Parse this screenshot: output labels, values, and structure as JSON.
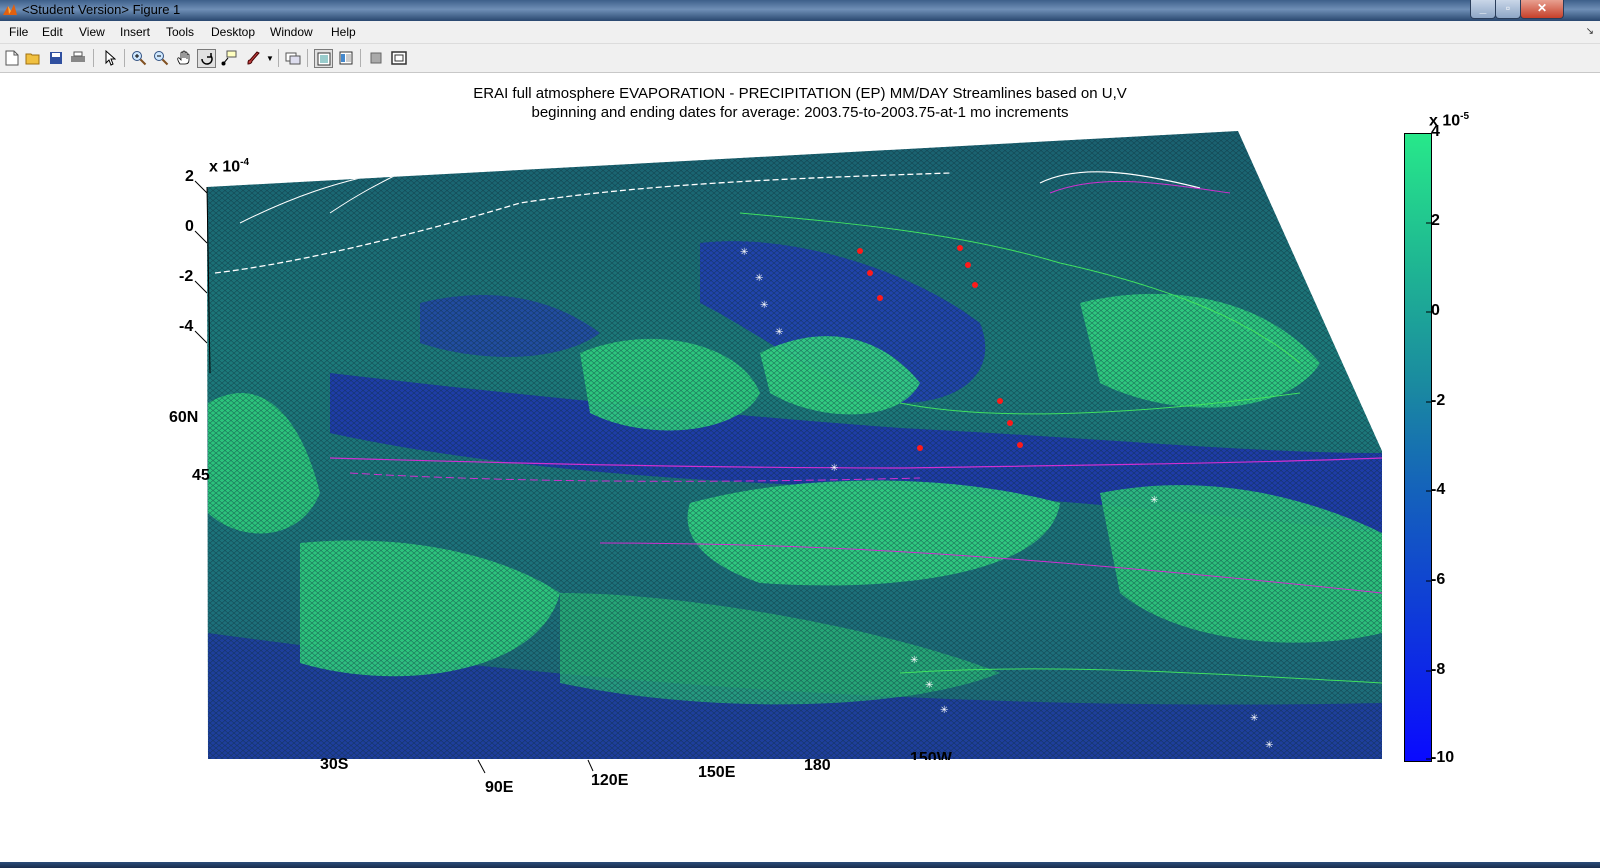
{
  "window": {
    "title": "<Student Version> Figure 1"
  },
  "menu": {
    "items": [
      "File",
      "Edit",
      "View",
      "Insert",
      "Tools",
      "Desktop",
      "Window",
      "Help"
    ]
  },
  "toolbar": {
    "icons": [
      "new-figure-icon",
      "open-file-icon",
      "save-icon",
      "print-icon",
      "edit-plot-arrow-icon",
      "zoom-in-icon",
      "zoom-out-icon",
      "pan-hand-icon",
      "rotate-3d-icon",
      "data-cursor-icon",
      "brush-icon",
      "link-plot-icon",
      "hide-plot-tools-icon",
      "show-plot-tools-icon",
      "colorbar-icon",
      "legend-icon"
    ]
  },
  "figure": {
    "title_line1": "ERAI full atmosphere  EVAPORATION - PRECIPITATION (EP)   MM/DAY   Streamlines based on U,V",
    "title_line2": "beginning and ending dates for average:  2003.75-to-2003.75-at-1 mo increments",
    "z_axis": {
      "exponent_base": "x 10",
      "exponent": "-4",
      "ticks": [
        "2",
        "0",
        "-2",
        "-4"
      ]
    },
    "lat_labels": [
      "60N",
      "45"
    ],
    "lon_labels": [
      "30S",
      "90E",
      "120E",
      "150E",
      "180",
      "150W"
    ],
    "colorbar": {
      "exponent_base": "x 10",
      "exponent": "-5",
      "ticks": [
        "4",
        "2",
        "0",
        "-2",
        "-4",
        "-6",
        "-8",
        "-10"
      ],
      "top_color": "#27e88a",
      "mid_color": "#1a7ea0",
      "bottom_color": "#0a0aff"
    }
  },
  "colors": {
    "surface_green": "#2fd07e",
    "surface_blue": "#2230b8",
    "surface_dark": "#0f3448",
    "streamline_white": "#ffffff",
    "streamline_magenta": "#d030d0",
    "streamline_green": "#40e060",
    "marker_red": "#ff1a1a"
  }
}
